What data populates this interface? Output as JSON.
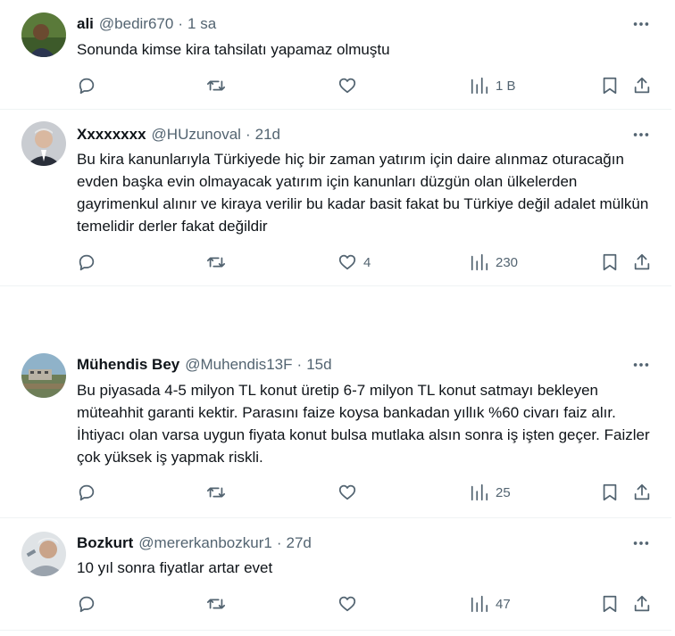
{
  "icons": {
    "more": "more-horizontal-icon",
    "reply": "reply-icon",
    "retweet": "retweet-icon",
    "like": "heart-icon",
    "views": "views-chart-icon",
    "bookmark": "bookmark-icon",
    "share": "share-icon"
  },
  "colors": {
    "text": "#0f1419",
    "secondary": "#536471",
    "divider": "#eff3f4"
  },
  "tweets": [
    {
      "name": "ali",
      "handle": "@bedir670",
      "time": "1 sa",
      "text": "Sonunda kimse kira tahsilatı yapamaz olmuştu",
      "replies": "",
      "retweets": "",
      "likes": "",
      "views": "1 B"
    },
    {
      "name": "Xxxxxxxx",
      "handle": "@HUzunoval",
      "time": "21d",
      "text": "Bu kira kanunlarıyla Türkiyede hiç bir zaman yatırım için daire alınmaz oturacağın evden başka evin olmayacak yatırım için kanunları düzgün olan ülkelerden gayrimenkul alınır ve kiraya verilir bu kadar basit fakat bu Türkiye değil adalet mülkün temelidir derler fakat değildir",
      "replies": "",
      "retweets": "",
      "likes": "4",
      "views": "230"
    },
    {
      "name": "Mühendis Bey",
      "handle": "@Muhendis13F",
      "time": "15d",
      "text": "Bu piyasada 4-5 milyon TL konut üretip 6-7 milyon TL konut satmayı bekleyen müteahhit garanti kektir. Parasını faize koysa bankadan yıllık %60 civarı faiz alır. İhtiyacı olan varsa uygun fiyata konut bulsa mutlaka alsın sonra iş işten geçer. Faizler çok yüksek iş yapmak riskli.",
      "replies": "",
      "retweets": "",
      "likes": "",
      "views": "25"
    },
    {
      "name": "Bozkurt",
      "handle": "@mererkanbozkur1",
      "time": "27d",
      "text": "10 yıl sonra fiyatlar artar evet",
      "replies": "",
      "retweets": "",
      "likes": "",
      "views": "47"
    }
  ]
}
